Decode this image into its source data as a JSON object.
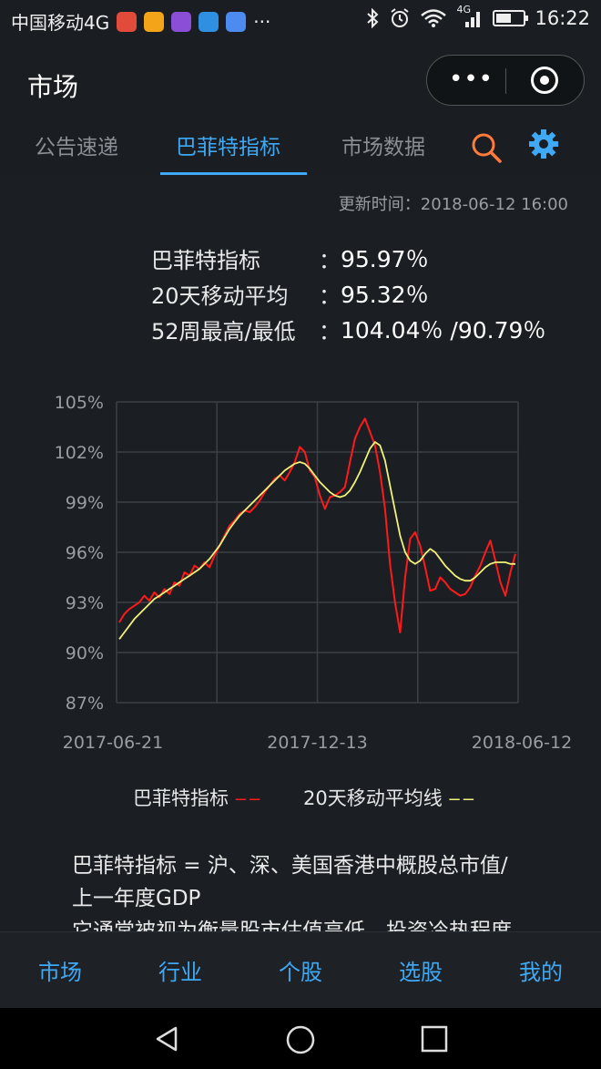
{
  "status_bar": {
    "carrier": "中国移动4G",
    "more": "···",
    "network": "4G",
    "time": "16:22"
  },
  "header": {
    "title": "市场"
  },
  "tabs": [
    {
      "label": "公告速递",
      "active": false
    },
    {
      "label": "巴菲特指标",
      "active": true
    },
    {
      "label": "市场数据",
      "active": false
    }
  ],
  "update_time": "更新时间：2018-06-12 16:00",
  "stats": [
    {
      "label": "巴菲特指标",
      "colon": "：",
      "value": "95.97％"
    },
    {
      "label": "20天移动平均",
      "colon": "：",
      "value": "95.32％"
    },
    {
      "label": "52周最高/最低",
      "colon": "：",
      "value": "104.04％ /90.79％"
    }
  ],
  "chart_data": {
    "type": "line",
    "ylim": [
      87,
      105
    ],
    "y_ticks": [
      "105%",
      "102%",
      "99%",
      "96%",
      "93%",
      "90%",
      "87%"
    ],
    "x_ticks": [
      "2017-06-21",
      "2017-12-13",
      "2018-06-12"
    ],
    "series": [
      {
        "name": "巴菲特指标",
        "color": "#ff1a1a",
        "values": [
          91.8,
          92.3,
          92.6,
          92.8,
          93.0,
          93.4,
          93.1,
          93.6,
          93.3,
          93.8,
          93.5,
          94.2,
          94.0,
          94.8,
          94.6,
          95.2,
          95.0,
          95.4,
          95.1,
          95.8,
          96.4,
          97.0,
          97.6,
          97.9,
          98.3,
          98.5,
          98.4,
          98.7,
          99.1,
          99.6,
          100.0,
          100.4,
          100.6,
          100.3,
          100.8,
          101.4,
          102.3,
          102.0,
          100.9,
          100.5,
          99.4,
          98.6,
          99.3,
          99.4,
          99.6,
          99.9,
          101.4,
          102.8,
          103.5,
          104.0,
          103.2,
          102.4,
          100.8,
          98.6,
          95.3,
          93.0,
          91.2,
          94.5,
          96.8,
          97.2,
          96.4,
          95.1,
          93.7,
          93.8,
          94.5,
          94.2,
          93.8,
          93.6,
          93.4,
          93.5,
          93.9,
          94.6,
          95.2,
          96.0,
          96.7,
          95.5,
          94.2,
          93.4,
          94.8,
          95.9
        ]
      },
      {
        "name": "20天移动平均线",
        "color": "#f2f27a",
        "values": [
          90.8,
          91.2,
          91.6,
          92.0,
          92.3,
          92.6,
          92.9,
          93.2,
          93.4,
          93.6,
          93.8,
          94.0,
          94.2,
          94.4,
          94.6,
          94.8,
          95.0,
          95.3,
          95.6,
          96.0,
          96.4,
          96.9,
          97.4,
          97.8,
          98.2,
          98.5,
          98.8,
          99.1,
          99.4,
          99.7,
          100.0,
          100.3,
          100.6,
          100.9,
          101.1,
          101.3,
          101.4,
          101.3,
          101.0,
          100.6,
          100.2,
          99.9,
          99.6,
          99.4,
          99.3,
          99.4,
          99.7,
          100.2,
          100.8,
          101.5,
          102.2,
          102.6,
          102.4,
          101.5,
          100.0,
          98.5,
          97.0,
          96.0,
          95.5,
          95.3,
          95.5,
          95.9,
          96.2,
          96.0,
          95.6,
          95.2,
          94.9,
          94.6,
          94.4,
          94.3,
          94.3,
          94.5,
          94.8,
          95.1,
          95.3,
          95.4,
          95.4,
          95.4,
          95.3,
          95.3
        ]
      }
    ]
  },
  "legend": [
    {
      "label": "巴菲特指标",
      "dash_color": "#ff1a1a"
    },
    {
      "label": "20天移动平均线",
      "dash_color": "#f2f27a"
    }
  ],
  "description": {
    "line1": "巴菲特指标 = 沪、深、美国香港中概股总市值/",
    "line2": "上一年度GDP",
    "line3": "它通常被视为衡量股市估值高低、投资冷热程度"
  },
  "bottom_nav": [
    "市场",
    "行业",
    "个股",
    "选股",
    "我的"
  ],
  "colors": {
    "accent": "#3fa9f5",
    "search": "#ff7a3d"
  }
}
